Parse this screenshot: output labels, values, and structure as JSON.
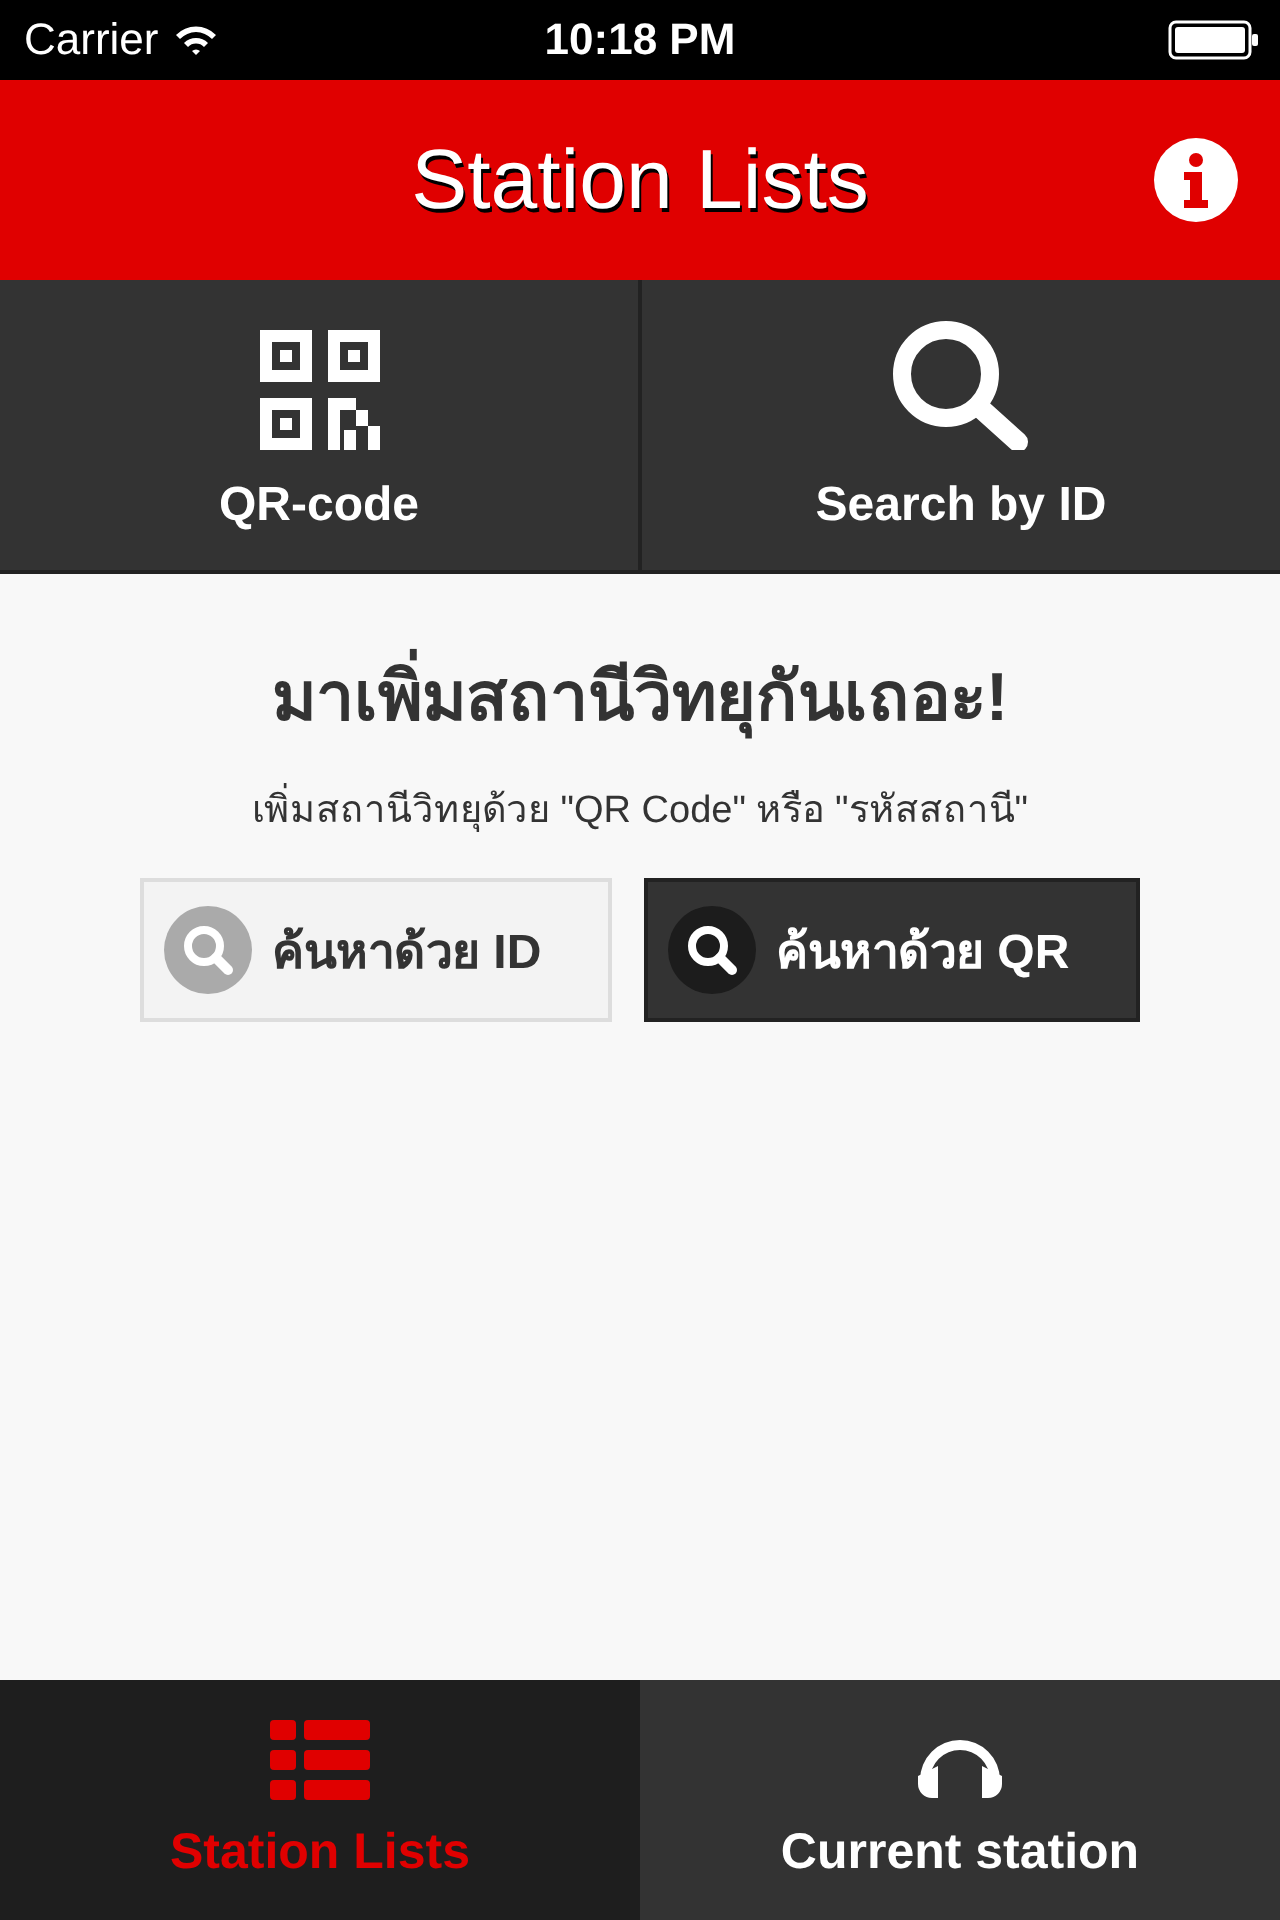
{
  "status_bar": {
    "carrier": "Carrier",
    "time": "10:18 PM"
  },
  "nav_bar": {
    "title": "Station Lists"
  },
  "top_actions": [
    {
      "label": "QR-code",
      "kind": "qr"
    },
    {
      "label": "Search by ID",
      "kind": "search"
    }
  ],
  "content": {
    "heading": "มาเพิ่มสถานีวิทยุกันเถอะ!",
    "subtitle": "เพิ่มสถานีวิทยุด้วย \"QR Code\" หรือ \"รหัสสถานี\"",
    "buttons": [
      {
        "label": "ค้นหาด้วย ID",
        "kind": "light"
      },
      {
        "label": "ค้นหาด้วย QR",
        "kind": "dark"
      }
    ]
  },
  "tab_bar": [
    {
      "label": "Station Lists",
      "kind": "list",
      "selected": true
    },
    {
      "label": "Current station",
      "kind": "headphones",
      "selected": false
    }
  ]
}
